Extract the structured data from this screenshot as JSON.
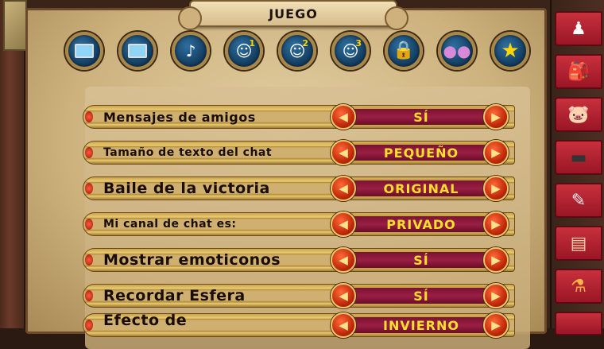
{
  "header": {
    "title": "JUEGO"
  },
  "icon_tabs": [
    {
      "icon": "monitor-icon",
      "glyph": "",
      "badge": ""
    },
    {
      "icon": "monitor-icon",
      "glyph": "",
      "badge": ""
    },
    {
      "icon": "audio-icon",
      "glyph": "♪",
      "badge": ""
    },
    {
      "icon": "chat-1-icon",
      "glyph": "☺",
      "badge": "1"
    },
    {
      "icon": "chat-2-icon",
      "glyph": "☺",
      "badge": "2"
    },
    {
      "icon": "chat-3-icon",
      "glyph": "☺",
      "badge": "3"
    },
    {
      "icon": "lock-icon",
      "glyph": "🔒",
      "badge": ""
    },
    {
      "icon": "bombs-icon",
      "glyph": "●●",
      "badge": ""
    },
    {
      "icon": "star-icon",
      "glyph": "★",
      "badge": ""
    }
  ],
  "settings": [
    {
      "label": "Mensajes de amigos",
      "value": "SÍ"
    },
    {
      "label": "Tamaño de texto del chat",
      "value": "PEQUEÑO"
    },
    {
      "label": "Baile de la victoria",
      "value": "ORIGINAL"
    },
    {
      "label": "Mi canal de chat es:",
      "value": "PRIVADO"
    },
    {
      "label": "Mostrar emoticonos",
      "value": "SÍ"
    },
    {
      "label": "Recordar Esfera",
      "value": "SÍ"
    },
    {
      "label": "Efecto de",
      "value": "INVIERNO"
    }
  ],
  "arrows": {
    "left": "◀",
    "right": "▶"
  },
  "sidebar_tabs": [
    {
      "icon": "character-icon",
      "glyph": "♟",
      "color": "#c8303c"
    },
    {
      "icon": "backpack-icon",
      "glyph": "🎒",
      "color": "#d9b07a"
    },
    {
      "icon": "pet-pig-icon",
      "glyph": "🐷",
      "color": "#f2a1c4"
    },
    {
      "icon": "deck-icon",
      "glyph": "▬",
      "color": "#555e66"
    },
    {
      "icon": "quill-icon",
      "glyph": "✎",
      "color": "#cfd6d8"
    },
    {
      "icon": "map-icon",
      "glyph": "▤",
      "color": "#d9c49a"
    },
    {
      "icon": "potion-icon",
      "glyph": "⚗",
      "color": "#e08a2a"
    }
  ]
}
